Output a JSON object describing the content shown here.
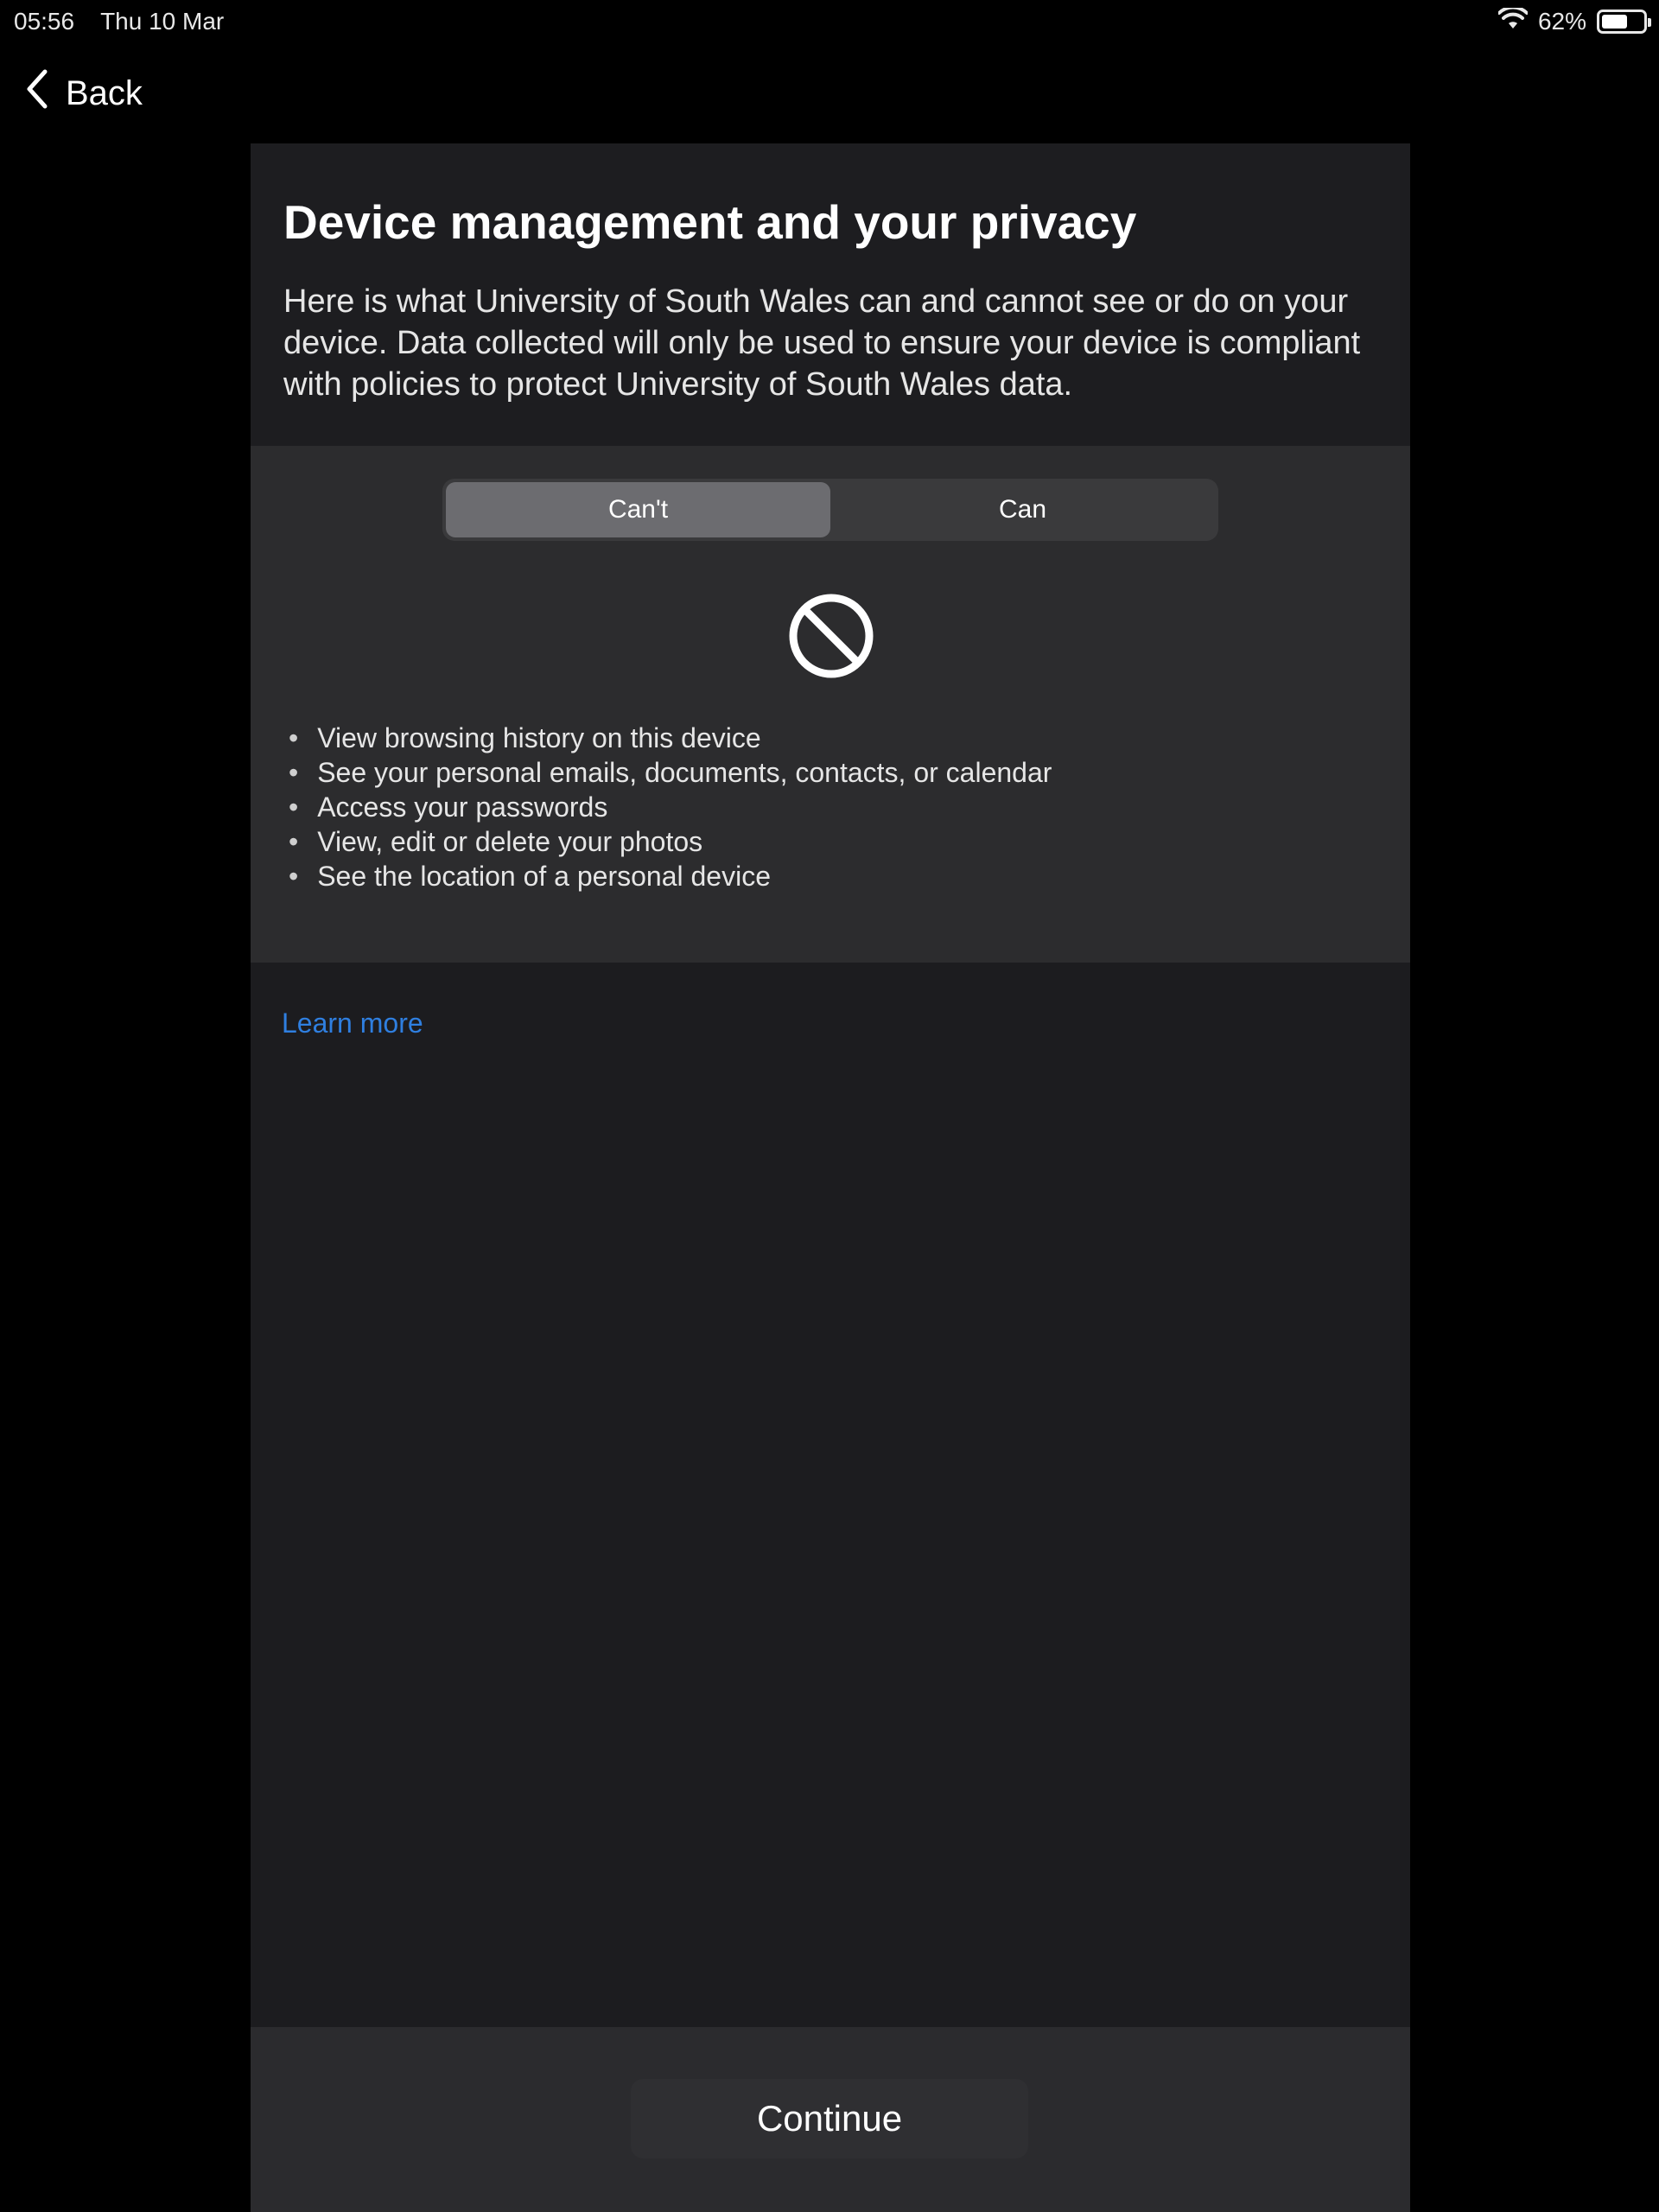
{
  "status_bar": {
    "time": "05:56",
    "date": "Thu 10 Mar",
    "battery_text": "62%",
    "battery_level": 0.62,
    "wifi_icon": "wifi-icon",
    "battery_icon": "battery-icon"
  },
  "nav": {
    "back_label": "Back",
    "back_icon": "chevron-left-icon"
  },
  "header": {
    "title": "Device management and your privacy",
    "intro": "Here is what University of South Wales can and cannot see or do on your device. Data collected will only be used to ensure your device is compliant with policies to protect University of South Wales data."
  },
  "segmented_control": {
    "options": [
      "Can't",
      "Can"
    ],
    "selected": "Can't"
  },
  "panel": {
    "icon": "prohibited-icon",
    "items": [
      "View browsing history on this device",
      "See your personal emails, documents, contacts, or calendar",
      "Access your passwords",
      "View, edit or delete your photos",
      "See the location of a personal device"
    ]
  },
  "links": {
    "learn_more": "Learn more"
  },
  "footer": {
    "continue_label": "Continue"
  },
  "colors": {
    "background": "#000000",
    "card": "#1c1c1f",
    "panel": "#2c2c2e",
    "segment_active": "#6c6c70",
    "link": "#2f7fe0"
  }
}
